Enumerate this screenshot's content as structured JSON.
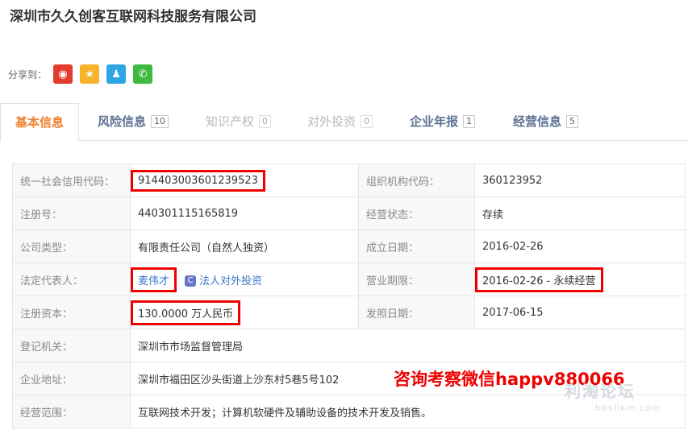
{
  "company_title": "深圳市久久创客互联网科技服务有限公司",
  "share": {
    "label": "分享到：",
    "icons": [
      {
        "name": "weibo-icon",
        "color": "#e23c2c",
        "glyph": "◉"
      },
      {
        "name": "qzone-icon",
        "color": "#f6b42c",
        "glyph": "★"
      },
      {
        "name": "qq-icon",
        "color": "#2ea6e6",
        "glyph": "♟"
      },
      {
        "name": "wechat-icon",
        "color": "#3fb93f",
        "glyph": "✆"
      }
    ]
  },
  "tabs": [
    {
      "label": "基本信息",
      "count": null,
      "state": "active"
    },
    {
      "label": "风险信息",
      "count": "10",
      "state": "normal"
    },
    {
      "label": "知识产权",
      "count": "0",
      "state": "muted"
    },
    {
      "label": "对外投资",
      "count": "0",
      "state": "muted"
    },
    {
      "label": "企业年报",
      "count": "1",
      "state": "normal"
    },
    {
      "label": "经营信息",
      "count": "5",
      "state": "normal"
    }
  ],
  "info": {
    "credit_code_label": "统一社会信用代码：",
    "credit_code": "914403003601239523",
    "org_code_label": "组织机构代码：",
    "org_code": "360123952",
    "reg_no_label": "注册号：",
    "reg_no": "440301115165819",
    "status_label": "经营状态：",
    "status": "存续",
    "type_label": "公司类型：",
    "type": "有限责任公司（自然人独资）",
    "found_label": "成立日期：",
    "found_date": "2016-02-26",
    "legal_label": "法定代表人：",
    "legal_rep": "麦伟才",
    "legal_invest_link": "法人对外投资",
    "term_label": "营业期限：",
    "term": "2016-02-26 - 永续经营",
    "capital_label": "注册资本：",
    "capital": "130.0000 万人民币",
    "issue_label": "发照日期：",
    "issue_date": "2017-06-15",
    "authority_label": "登记机关：",
    "authority": "深圳市市场监督管理局",
    "address_label": "企业地址：",
    "address": "深圳市福田区沙头街道上沙东村5巷5号102",
    "scope_label": "经营范围：",
    "scope": "互联网技术开发；计算机软硬件及辅助设备的技术开发及销售。"
  },
  "watermark": "咨询考察微信happv880066",
  "logo_text": "利淘论坛",
  "logo_sub": "bbslixin.com"
}
